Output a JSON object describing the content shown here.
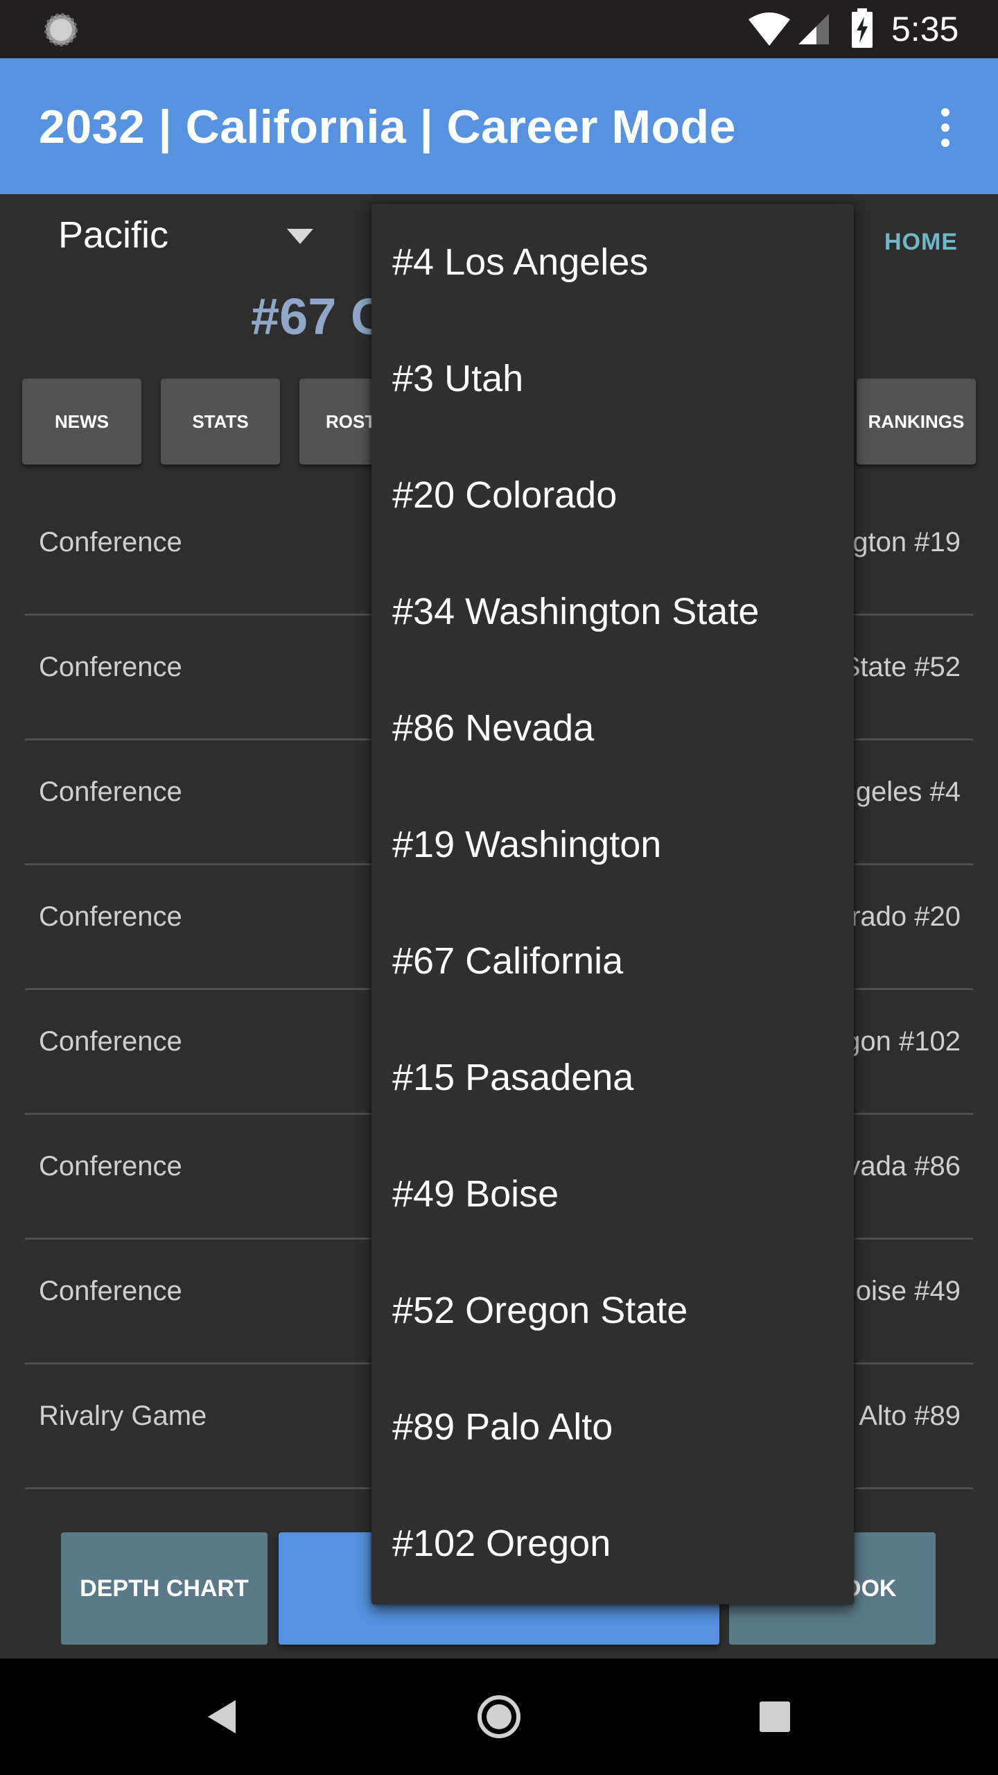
{
  "status_bar": {
    "time": "5:35"
  },
  "app_bar": {
    "title": "2032 | California | Career Mode"
  },
  "conference_spinner": {
    "selected": "Pacific"
  },
  "home_link": "HOME",
  "team_rank_header": "#67 C",
  "tabs": {
    "news": "NEWS",
    "stats": "STATS",
    "roster": "ROST",
    "rankings": "RANKINGS"
  },
  "schedule": [
    {
      "type": "Conference",
      "opponent": "gton #19"
    },
    {
      "type": "Conference",
      "opponent": "State #52"
    },
    {
      "type": "Conference",
      "opponent": "ngeles #4"
    },
    {
      "type": "Conference",
      "opponent": "rado #20"
    },
    {
      "type": "Conference",
      "opponent": "gon #102"
    },
    {
      "type": "Conference",
      "opponent": "vada #86"
    },
    {
      "type": "Conference",
      "opponent": "oise #49"
    },
    {
      "type": "Rivalry Game",
      "opponent": "Alto #89"
    }
  ],
  "bottom_buttons": {
    "depth_chart": "DEPTH CHART",
    "play": "",
    "playbook": "OOK"
  },
  "dropdown": {
    "items": [
      "#4 Los Angeles",
      "#3 Utah",
      "#20 Colorado",
      "#34 Washington State",
      "#86 Nevada",
      "#19 Washington",
      "#67 California",
      "#15 Pasadena",
      "#49 Boise",
      "#52 Oregon State",
      "#89 Palo Alto",
      "#102 Oregon"
    ]
  },
  "colors": {
    "app_bar": "#5692e0",
    "background": "#2e2e2e",
    "home_link": "#6fb8c9",
    "secondary_button": "#5a7a8a"
  }
}
